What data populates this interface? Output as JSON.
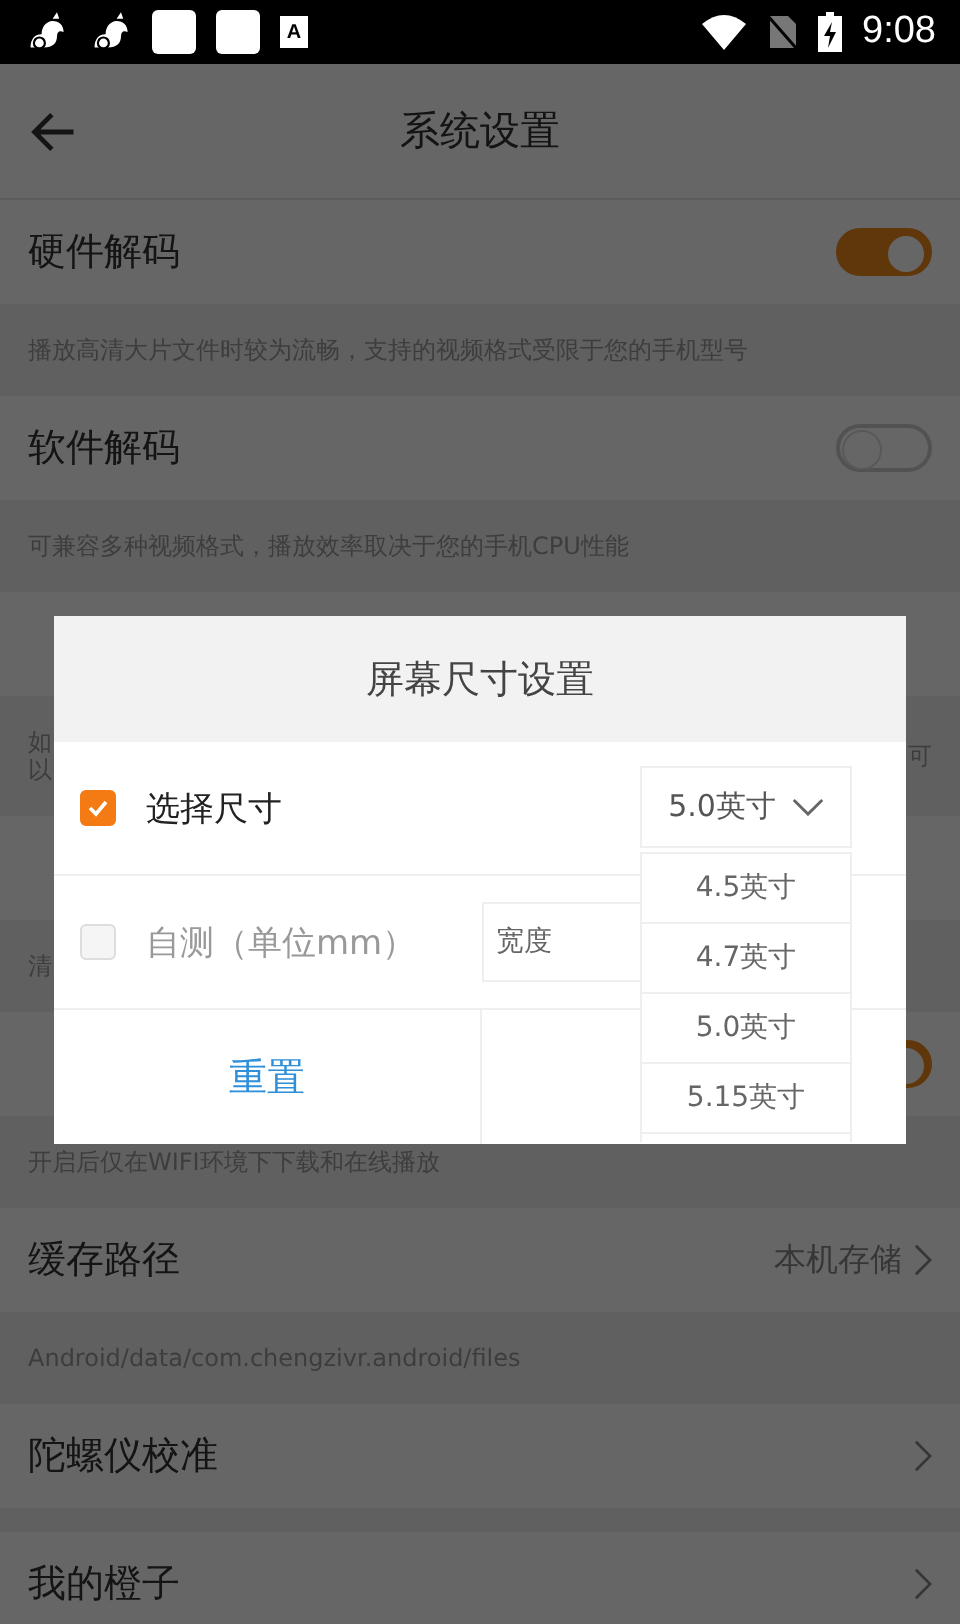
{
  "status_bar": {
    "badge": "A",
    "time": "9:08"
  },
  "header": {
    "title": "系统设置"
  },
  "settings": [
    {
      "kind": "toggle",
      "label": "硬件解码",
      "on": true
    },
    {
      "kind": "desc",
      "lines": [
        "播放高清大片文件时较为流畅，支持的视频格式受限于您的手机型号"
      ]
    },
    {
      "kind": "toggle",
      "label": "软件解码",
      "on": false
    },
    {
      "kind": "desc",
      "lines": [
        "可兼容多种视频格式，播放效率取决于您的手机CPU性能"
      ]
    },
    {
      "kind": "plain"
    },
    {
      "kind": "desc",
      "lines": [
        "如",
        "以"
      ],
      "trailing": "可"
    },
    {
      "kind": "plain"
    },
    {
      "kind": "desc",
      "lines": [
        "清"
      ]
    },
    {
      "kind": "toggle",
      "on": true
    },
    {
      "kind": "desc",
      "lines": [
        "开启后仅在WIFI环境下下载和在线播放"
      ]
    },
    {
      "kind": "link",
      "label": "缓存路径",
      "value": "本机存储"
    },
    {
      "kind": "desc",
      "lines": [
        "Android/data/com.chengzivr.android/files"
      ]
    },
    {
      "kind": "link",
      "label": "陀螺仪校准"
    },
    {
      "kind": "gap"
    },
    {
      "kind": "link",
      "label": "我的橙子"
    }
  ],
  "dialog": {
    "title": "屏幕尺寸设置",
    "options": [
      {
        "label": "选择尺寸",
        "checked": true
      },
      {
        "label": "自测（单位mm）",
        "checked": false
      }
    ],
    "dropdown": {
      "value": "5.0英寸",
      "items": [
        "4.5英寸",
        "4.7英寸",
        "5.0英寸",
        "5.15英寸"
      ]
    },
    "width_placeholder": "宽度",
    "buttons": [
      "重置"
    ]
  }
}
